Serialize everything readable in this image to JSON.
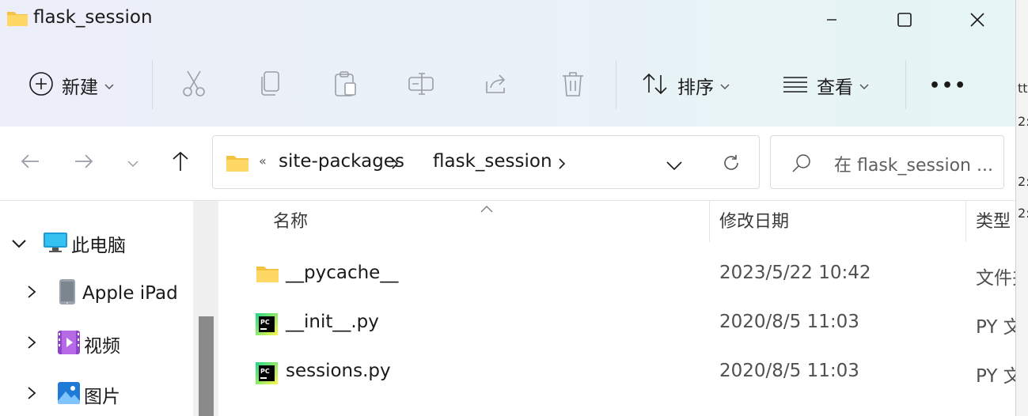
{
  "window": {
    "title": "flask_session"
  },
  "toolbar": {
    "new_label": "新建",
    "sort_label": "排序",
    "view_label": "查看",
    "more_label": "•••"
  },
  "address": {
    "overflow": "«",
    "segments": [
      "site-packages",
      "flask_session"
    ]
  },
  "search": {
    "placeholder": "在 flask_session ..."
  },
  "sidebar": {
    "items": [
      {
        "label": "此电脑",
        "icon": "computer-icon",
        "expanded": true
      },
      {
        "label": "Apple iPad",
        "icon": "ipad-icon"
      },
      {
        "label": "视频",
        "icon": "video-folder-icon"
      },
      {
        "label": "图片",
        "icon": "pictures-folder-icon"
      }
    ]
  },
  "columns": {
    "name": "名称",
    "modified": "修改日期",
    "type": "类型"
  },
  "files": [
    {
      "name": "__pycache__",
      "modified": "2023/5/22 10:42",
      "type": "文件夹",
      "icon": "folder-icon"
    },
    {
      "name": "__init__.py",
      "modified": "2020/8/5 11:03",
      "type": "PY 文件",
      "icon": "pycharm-file-icon"
    },
    {
      "name": "sessions.py",
      "modified": "2020/8/5 11:03",
      "type": "PY 文件",
      "icon": "pycharm-file-icon"
    }
  ],
  "background_window_chars": [
    "tt",
    "2:",
    "2:",
    "2:"
  ]
}
